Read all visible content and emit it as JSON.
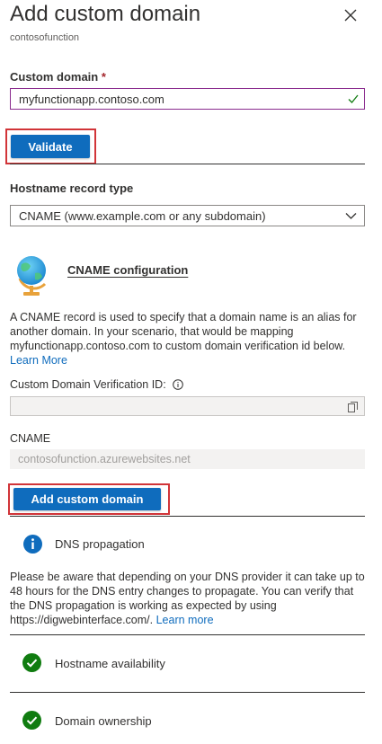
{
  "header": {
    "title": "Add custom domain",
    "subtitle": "contosofunction"
  },
  "custom_domain": {
    "label": "Custom domain",
    "required_mark": "*",
    "value": "myfunctionapp.contoso.com"
  },
  "validate_label": "Validate",
  "hostname_record": {
    "label": "Hostname record type",
    "selected": "CNAME (www.example.com or any subdomain)"
  },
  "cname_config": {
    "heading": "CNAME configuration",
    "description": "A CNAME record is used to specify that a domain name is an alias for another domain. In your scenario, that would be mapping myfunctionapp.contoso.com to custom domain verification id below.",
    "learn_more": "Learn More"
  },
  "verification": {
    "label": "Custom Domain Verification ID:",
    "value": ""
  },
  "cname": {
    "label": "CNAME",
    "value": "contosofunction.azurewebsites.net"
  },
  "add_domain_label": "Add custom domain",
  "dns": {
    "title": "DNS propagation",
    "text": "Please be aware that depending on your DNS provider it can take up to 48 hours for the DNS entry changes to propagate. You can verify that the DNS propagation is working as expected by using https://digwebinterface.com/.",
    "learn_more": "Learn more"
  },
  "checks": [
    {
      "label": "Hostname availability"
    },
    {
      "label": "Domain ownership"
    }
  ],
  "colors": {
    "accent": "#0f6cbd",
    "success": "#107c10",
    "highlight": "#d13438"
  }
}
